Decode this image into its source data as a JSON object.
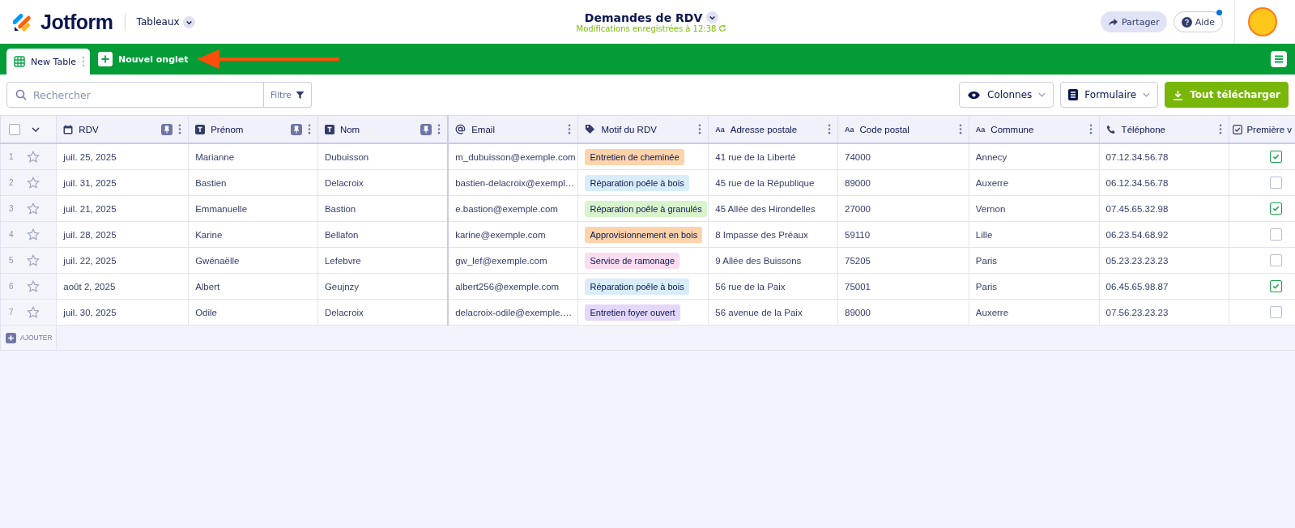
{
  "header": {
    "logo": "Jotform",
    "section": "Tableaux",
    "title": "Demandes de RDV",
    "status": "Modifications enregistrées à 12:38",
    "buttons": [
      {
        "label": "Partager",
        "kind": "share"
      },
      {
        "label": "Aide",
        "kind": "help"
      }
    ]
  },
  "tabs": [
    {
      "label": "New Table",
      "selected": true
    }
  ],
  "new_tab": "Nouvel onglet",
  "toolbar": {
    "search": {
      "placeholder": "Rechercher"
    },
    "filter": "Filtre",
    "buttons": [
      {
        "label": "Colonnes",
        "kind": "columns"
      },
      {
        "label": "Formulaire",
        "kind": "form"
      },
      {
        "label": "Tout télécharger",
        "kind": "download"
      }
    ]
  },
  "table": {
    "select_all": {
      "checked": false
    },
    "columns": [
      {
        "label": "RDV",
        "kind": "date",
        "pinned": true
      },
      {
        "label": "Prénom",
        "kind": "text",
        "pinned": true
      },
      {
        "label": "Nom",
        "kind": "text",
        "pinned": true
      },
      {
        "label": "Email",
        "kind": "email",
        "pinned": false
      },
      {
        "label": "Motif du RDV",
        "kind": "tag",
        "pinned": false
      },
      {
        "label": "Adresse postale",
        "kind": "short",
        "icon_text": "Aa",
        "pinned": false
      },
      {
        "label": "Code postal",
        "kind": "short",
        "icon_text": "Aa",
        "pinned": false
      },
      {
        "label": "Commune",
        "kind": "short",
        "icon_text": "Aa",
        "pinned": false
      },
      {
        "label": "Téléphone",
        "kind": "phone",
        "pinned": false
      },
      {
        "label": "Première v",
        "kind": "checkbox"
      }
    ],
    "rows": [
      {
        "number": "1",
        "starred": false,
        "cells": [
          "juil. 25, 2025",
          "Marianne",
          "Dubuisson",
          "m_dubuisson@exemple.com",
          {
            "text": "Entretien de cheminée",
            "color": "#fdd3ab"
          },
          "41 rue de la Liberté",
          "74000",
          "Annecy",
          "07.12.34.56.78",
          true
        ]
      },
      {
        "number": "2",
        "starred": false,
        "cells": [
          "juil. 31, 2025",
          "Bastien",
          "Delacroix",
          "bastien-delacroix@exempl…",
          {
            "text": "Réparation poêle à bois",
            "color": "#d8edf9"
          },
          "45 rue de la République",
          "89000",
          "Auxerre",
          "06.12.34.56.78",
          false
        ]
      },
      {
        "number": "3",
        "starred": false,
        "cells": [
          "juil. 21, 2025",
          "Emmanuelle",
          "Bastion",
          "e.bastion@exemple.com",
          {
            "text": "Réparation poêle à granulés",
            "color": "#d9f4cc"
          },
          "45 Allée des Hirondelles",
          "27000",
          "Vernon",
          "07.45.65.32.98",
          true
        ]
      },
      {
        "number": "4",
        "starred": false,
        "cells": [
          "juil. 28, 2025",
          "Karine",
          "Bellafon",
          "karine@exemple.com",
          {
            "text": "Approvisionnement en bois",
            "color": "#fdd3ab"
          },
          "8 Impasse des Préaux",
          "59110",
          "Lille",
          "06.23.54.68.92",
          false
        ]
      },
      {
        "number": "5",
        "starred": false,
        "cells": [
          "juil. 22, 2025",
          "Gwénaëlle",
          "Lefebvre",
          "gw_lef@exemple.com",
          {
            "text": "Service de ramonage",
            "color": "#fcdcf0"
          },
          "9 Allée des Buissons",
          "75205",
          "Paris",
          "05.23.23.23.23",
          false
        ]
      },
      {
        "number": "6",
        "starred": false,
        "cells": [
          "août 2, 2025",
          "Albert",
          "Geujnzy",
          "albert256@exemple.com",
          {
            "text": "Réparation poêle à bois",
            "color": "#d8edf9"
          },
          "56 rue de la Paix",
          "75001",
          "Paris",
          "06.45.65.98.87",
          true
        ]
      },
      {
        "number": "7",
        "starred": false,
        "cells": [
          "juil. 30, 2025",
          "Odile",
          "Delacroix",
          "delacroix-odile@exemple.…",
          {
            "text": "Entretien foyer ouvert",
            "color": "#e3d7fb"
          },
          "56 avenue de la Paix",
          "89000",
          "Auxerre",
          "07.56.23.23.23",
          false
        ]
      }
    ],
    "add_row": "AJOUTER"
  }
}
